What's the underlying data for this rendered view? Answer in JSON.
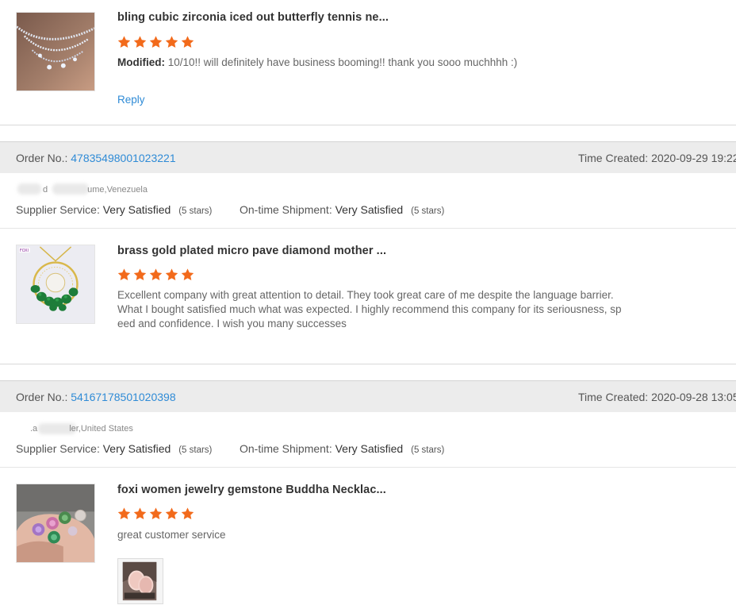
{
  "reviews": [
    {
      "title": "bling cubic zirconia iced out butterfly tennis ne...",
      "rating": 5,
      "review_prefix": "Modified:",
      "review": "10/10!! will definitely have business booming!! thank you sooo muchhhh :)",
      "reply_label": "Reply"
    },
    {
      "order_label": "Order No.:",
      "order_no": "47835498001023221",
      "time_label": "Time Created:",
      "time": "2020-09-29 19:22",
      "location": "ume,Venezuela",
      "location_prefix": "d",
      "supplier_label": "Supplier Service:",
      "supplier_value": "Very Satisfied",
      "supplier_stars": "(5 stars)",
      "shipment_label": "On-time Shipment:",
      "shipment_value": "Very Satisfied",
      "shipment_stars": "(5 stars)",
      "title": "brass gold plated micro pave diamond mother ...",
      "rating": 5,
      "review_lines": [
        "Excellent company with great attention to detail. They took great care of me despite the language barrier.",
        "What I bought satisfied much what was expected. I highly recommend this company for its seriousness, sp",
        "eed and confidence. I wish you many successes"
      ]
    },
    {
      "order_label": "Order No.:",
      "order_no": "54167178501020398",
      "time_label": "Time Created:",
      "time": "2020-09-28 13:05",
      "location": "ler,United States",
      "location_prefix": ".a",
      "supplier_label": "Supplier Service:",
      "supplier_value": "Very Satisfied",
      "supplier_stars": "(5 stars)",
      "shipment_label": "On-time Shipment:",
      "shipment_value": "Very Satisfied",
      "shipment_stars": "(5 stars)",
      "title": "foxi women jewelry gemstone Buddha Necklac...",
      "rating": 5,
      "review": "great customer service"
    }
  ],
  "colors": {
    "star": "#f26a1b",
    "link": "#2f8bd6",
    "order_bar": "#ececec"
  }
}
